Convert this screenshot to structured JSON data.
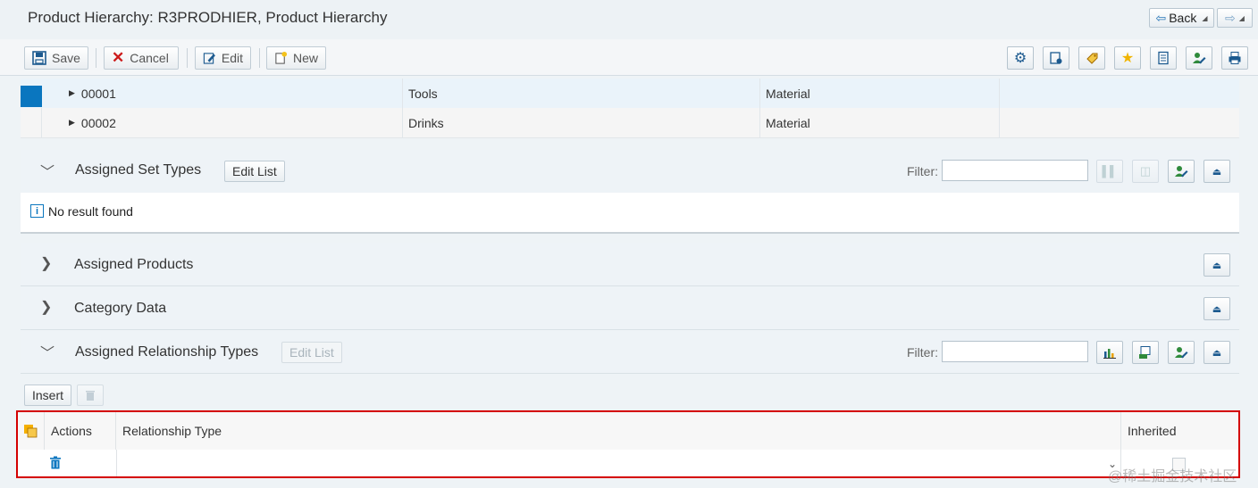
{
  "header": {
    "title": "Product Hierarchy: R3PRODHIER, Product Hierarchy",
    "back_label": "Back"
  },
  "toolbar": {
    "save_label": "Save",
    "cancel_label": "Cancel",
    "edit_label": "Edit",
    "new_label": "New",
    "right_icons": [
      "settings-icon",
      "personalize-icon",
      "tag-icon",
      "favorite-add-icon",
      "notes-icon",
      "user-edit-icon",
      "print-icon"
    ]
  },
  "tree": {
    "rows": [
      {
        "id": "00001",
        "description": "Tools",
        "type": "Material"
      },
      {
        "id": "00002",
        "description": "Drinks",
        "type": "Material"
      }
    ]
  },
  "assigned_set_types": {
    "title": "Assigned Set Types",
    "edit_list_label": "Edit List",
    "filter_label": "Filter:",
    "filter_value": "",
    "no_result": "No result found"
  },
  "assigned_products": {
    "title": "Assigned Products"
  },
  "category_data": {
    "title": "Category Data"
  },
  "assigned_relationship_types": {
    "title": "Assigned Relationship Types",
    "edit_list_label": "Edit List",
    "filter_label": "Filter:",
    "filter_value": "",
    "insert_label": "Insert",
    "columns": {
      "actions": "Actions",
      "relationship_type": "Relationship Type",
      "inherited": "Inherited"
    }
  },
  "watermark": "@稀土掘金技术社区",
  "colors": {
    "accent": "#0a76bf",
    "highlight_border": "#d40000"
  }
}
